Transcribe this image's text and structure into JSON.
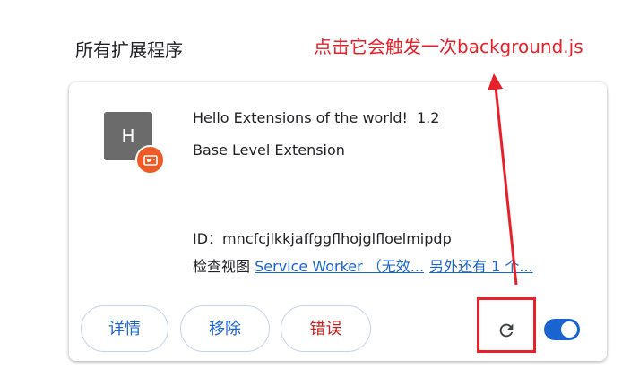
{
  "section": {
    "title": "所有扩展程序"
  },
  "annotation": {
    "text": "点击它会触发一次background.js",
    "color": "#e8202a"
  },
  "extension": {
    "icon_letter": "H",
    "name": "Hello Extensions of the world!",
    "version": "1.2",
    "description": "Base Level Extension",
    "id_label": "ID：",
    "id_value": "mncfcjlkkjaffggflhojglfloelmipdp",
    "inspect_label": "检查视图",
    "inspect_links": [
      "Service Worker （无效...",
      "另外还有 1 个..."
    ],
    "badge_icon": "camera-icon"
  },
  "buttons": {
    "details": "详情",
    "remove": "移除",
    "errors": "错误"
  },
  "controls": {
    "reload_icon": "reload-icon",
    "enabled": true
  },
  "colors": {
    "link": "#1a64d0",
    "error": "#c5221f",
    "toggle_on": "#1a64d0"
  }
}
